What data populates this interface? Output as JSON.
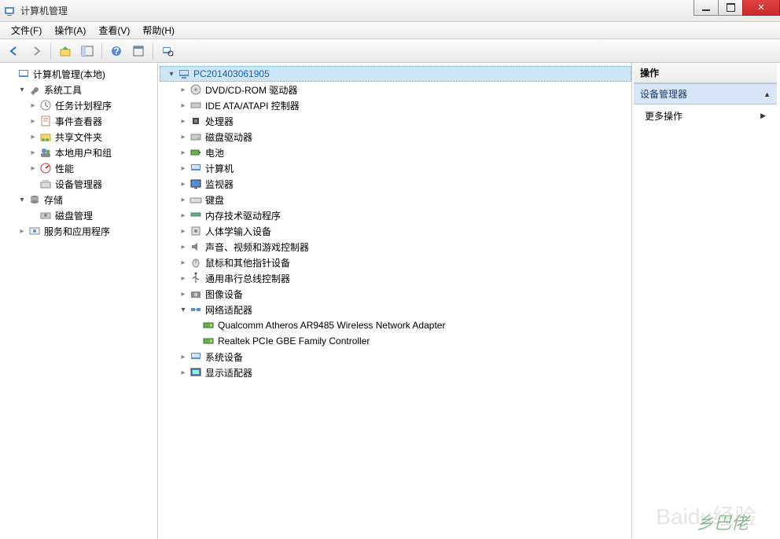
{
  "window": {
    "title": "计算机管理"
  },
  "menu": {
    "file": "文件(F)",
    "action": "操作(A)",
    "view": "查看(V)",
    "help": "帮助(H)"
  },
  "left_tree": {
    "root": "计算机管理(本地)",
    "system_tools": "系统工具",
    "task_scheduler": "任务计划程序",
    "event_viewer": "事件查看器",
    "shared_folders": "共享文件夹",
    "local_users": "本地用户和组",
    "performance": "性能",
    "device_manager": "设备管理器",
    "storage": "存储",
    "disk_mgmt": "磁盘管理",
    "services_apps": "服务和应用程序"
  },
  "center_tree": {
    "computer": "PC201403061905",
    "dvd": "DVD/CD-ROM 驱动器",
    "ide": "IDE ATA/ATAPI 控制器",
    "processor": "处理器",
    "disk_drives": "磁盘驱动器",
    "battery": "电池",
    "computers": "计算机",
    "monitor": "监视器",
    "keyboard": "键盘",
    "memory_tech": "内存技术驱动程序",
    "hid": "人体学输入设备",
    "sound": "声音、视频和游戏控制器",
    "mouse": "鼠标和其他指针设备",
    "usb": "通用串行总线控制器",
    "imaging": "图像设备",
    "network": "网络适配器",
    "nic1": "Qualcomm Atheros AR9485 Wireless Network Adapter",
    "nic2": "Realtek PCIe GBE Family Controller",
    "system_devices": "系统设备",
    "display": "显示适配器"
  },
  "right_pane": {
    "header": "操作",
    "section": "设备管理器",
    "more_actions": "更多操作"
  },
  "watermark": {
    "baidu": "Baidu经验",
    "bottom": "乡巴佬"
  }
}
